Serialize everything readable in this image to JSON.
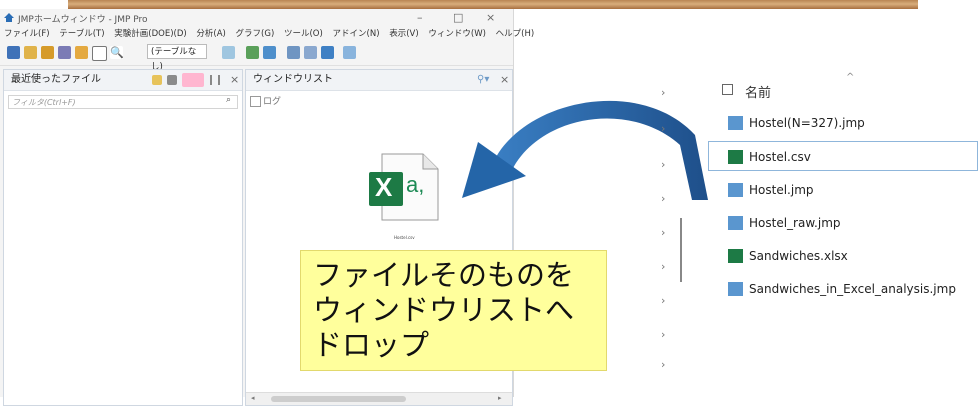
{
  "window": {
    "title": "JMPホームウィンドウ - JMP Pro",
    "controls": [
      "–",
      "□",
      "×"
    ]
  },
  "menu": [
    "ファイル(F)",
    "テーブル(T)",
    "実験計画(DOE)(D)",
    "分析(A)",
    "グラフ(G)",
    "ツール(O)",
    "アドイン(N)",
    "表示(V)",
    "ウィンドウ(W)",
    "ヘルプ(H)"
  ],
  "toolbar": {
    "table_select": "(テーブルなし)"
  },
  "left_pane": {
    "title": "最近使ったファイル",
    "filter_placeholder": "フィルタ(Ctrl+F)"
  },
  "right_pane": {
    "title": "ウィンドウリスト",
    "log_label": "ログ"
  },
  "drag_file": {
    "icon": "excel-file-icon",
    "letter": "X",
    "glyph": "a,",
    "caption": "Hostel.csv"
  },
  "explorer": {
    "column_name": "名前",
    "files": [
      {
        "name": "Hostel(N=327).jmp",
        "icon": "jmp-file-icon"
      },
      {
        "name": "Hostel.csv",
        "icon": "excel-csv-icon",
        "selected": true
      },
      {
        "name": "Hostel.jmp",
        "icon": "jmp-file-icon"
      },
      {
        "name": "Hostel_raw.jmp",
        "icon": "jmp-file-icon"
      },
      {
        "name": "Sandwiches.xlsx",
        "icon": "excel-xlsx-icon"
      },
      {
        "name": "Sandwiches_in_Excel_analysis.jmp",
        "icon": "jmp-file-icon"
      }
    ]
  },
  "callout": {
    "line1": "ファイルそのものを",
    "line2": "ウィンドウリストへ",
    "line3": "ドロップ"
  },
  "colors": {
    "arrow": "#2465a8",
    "callout_bg": "#ffff9c",
    "excel_green": "#1d7a45"
  }
}
